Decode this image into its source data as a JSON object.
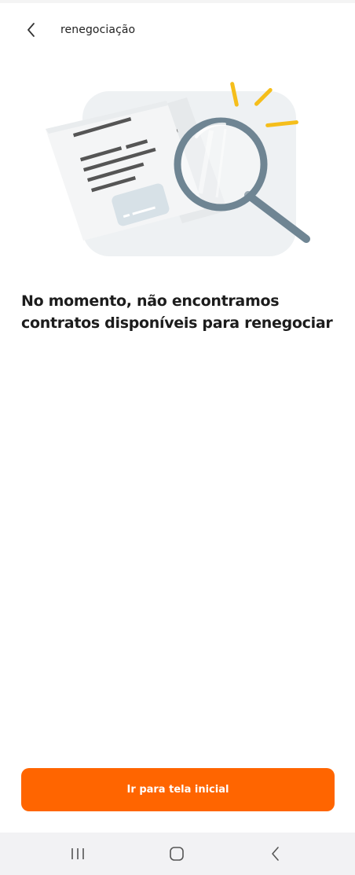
{
  "header": {
    "title": "renegociação",
    "back_icon": "chevron-left-icon"
  },
  "illustration": {
    "icon": "document-magnifier-illustration",
    "colors": {
      "background": "#eef1f3",
      "paper": "#f4f5f6",
      "lines": "#555555",
      "lens_frame": "#6f8593",
      "accent": "#f5be1b",
      "card": "#d7e1e7"
    }
  },
  "message": {
    "text": "No momento, não encontramos contratos disponíveis para renegociar"
  },
  "primary_button": {
    "label": "Ir para tela inicial",
    "color": "#ff6500"
  },
  "system_nav": {
    "recents_icon": "recents-icon",
    "home_icon": "home-icon",
    "back_icon": "back-icon"
  }
}
